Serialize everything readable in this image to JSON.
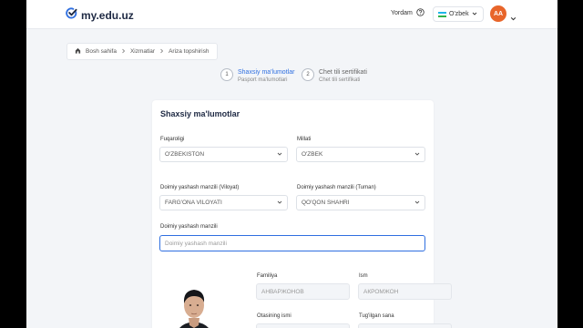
{
  "header": {
    "logo_text": "my.edu.uz",
    "help_label": "Yordam",
    "language": "O'zbek",
    "avatar_initials": "AA"
  },
  "breadcrumb": [
    "Bosh sahifa",
    "Xizmatlar",
    "Ariza topshirish"
  ],
  "steps": [
    {
      "number": "1",
      "title": "Shaxsiy ma'lumotlar",
      "subtitle": "Pasport ma'lumotlari"
    },
    {
      "number": "2",
      "title": "Chet tili sertifikati",
      "subtitle": "Chet tili sertifikati"
    }
  ],
  "form": {
    "title": "Shaxsiy ma'lumotlar",
    "citizenship": {
      "label": "Fuqaroligi",
      "value": "O'ZBEKISTON"
    },
    "nationality": {
      "label": "Millati",
      "value": "O'ZBEK"
    },
    "region": {
      "label": "Doimiy yashash manzili (Viloyat)",
      "value": "FARG'ONA VILOYATI"
    },
    "district": {
      "label": "Doimiy yashash manzili (Tuman)",
      "value": "QO'QON SHAHRI"
    },
    "address": {
      "label": "Doimiy yashash manzili",
      "placeholder": "Doimiy yashash manzili"
    },
    "surname": {
      "label": "Familiya",
      "value": "АНВАРЖОНОВ"
    },
    "first_name": {
      "label": "Ism",
      "value": "АКРОМЖОН"
    },
    "patronymic": {
      "label": "Otasining ismi"
    },
    "birth_date": {
      "label": "Tug'ilgan sana"
    }
  }
}
